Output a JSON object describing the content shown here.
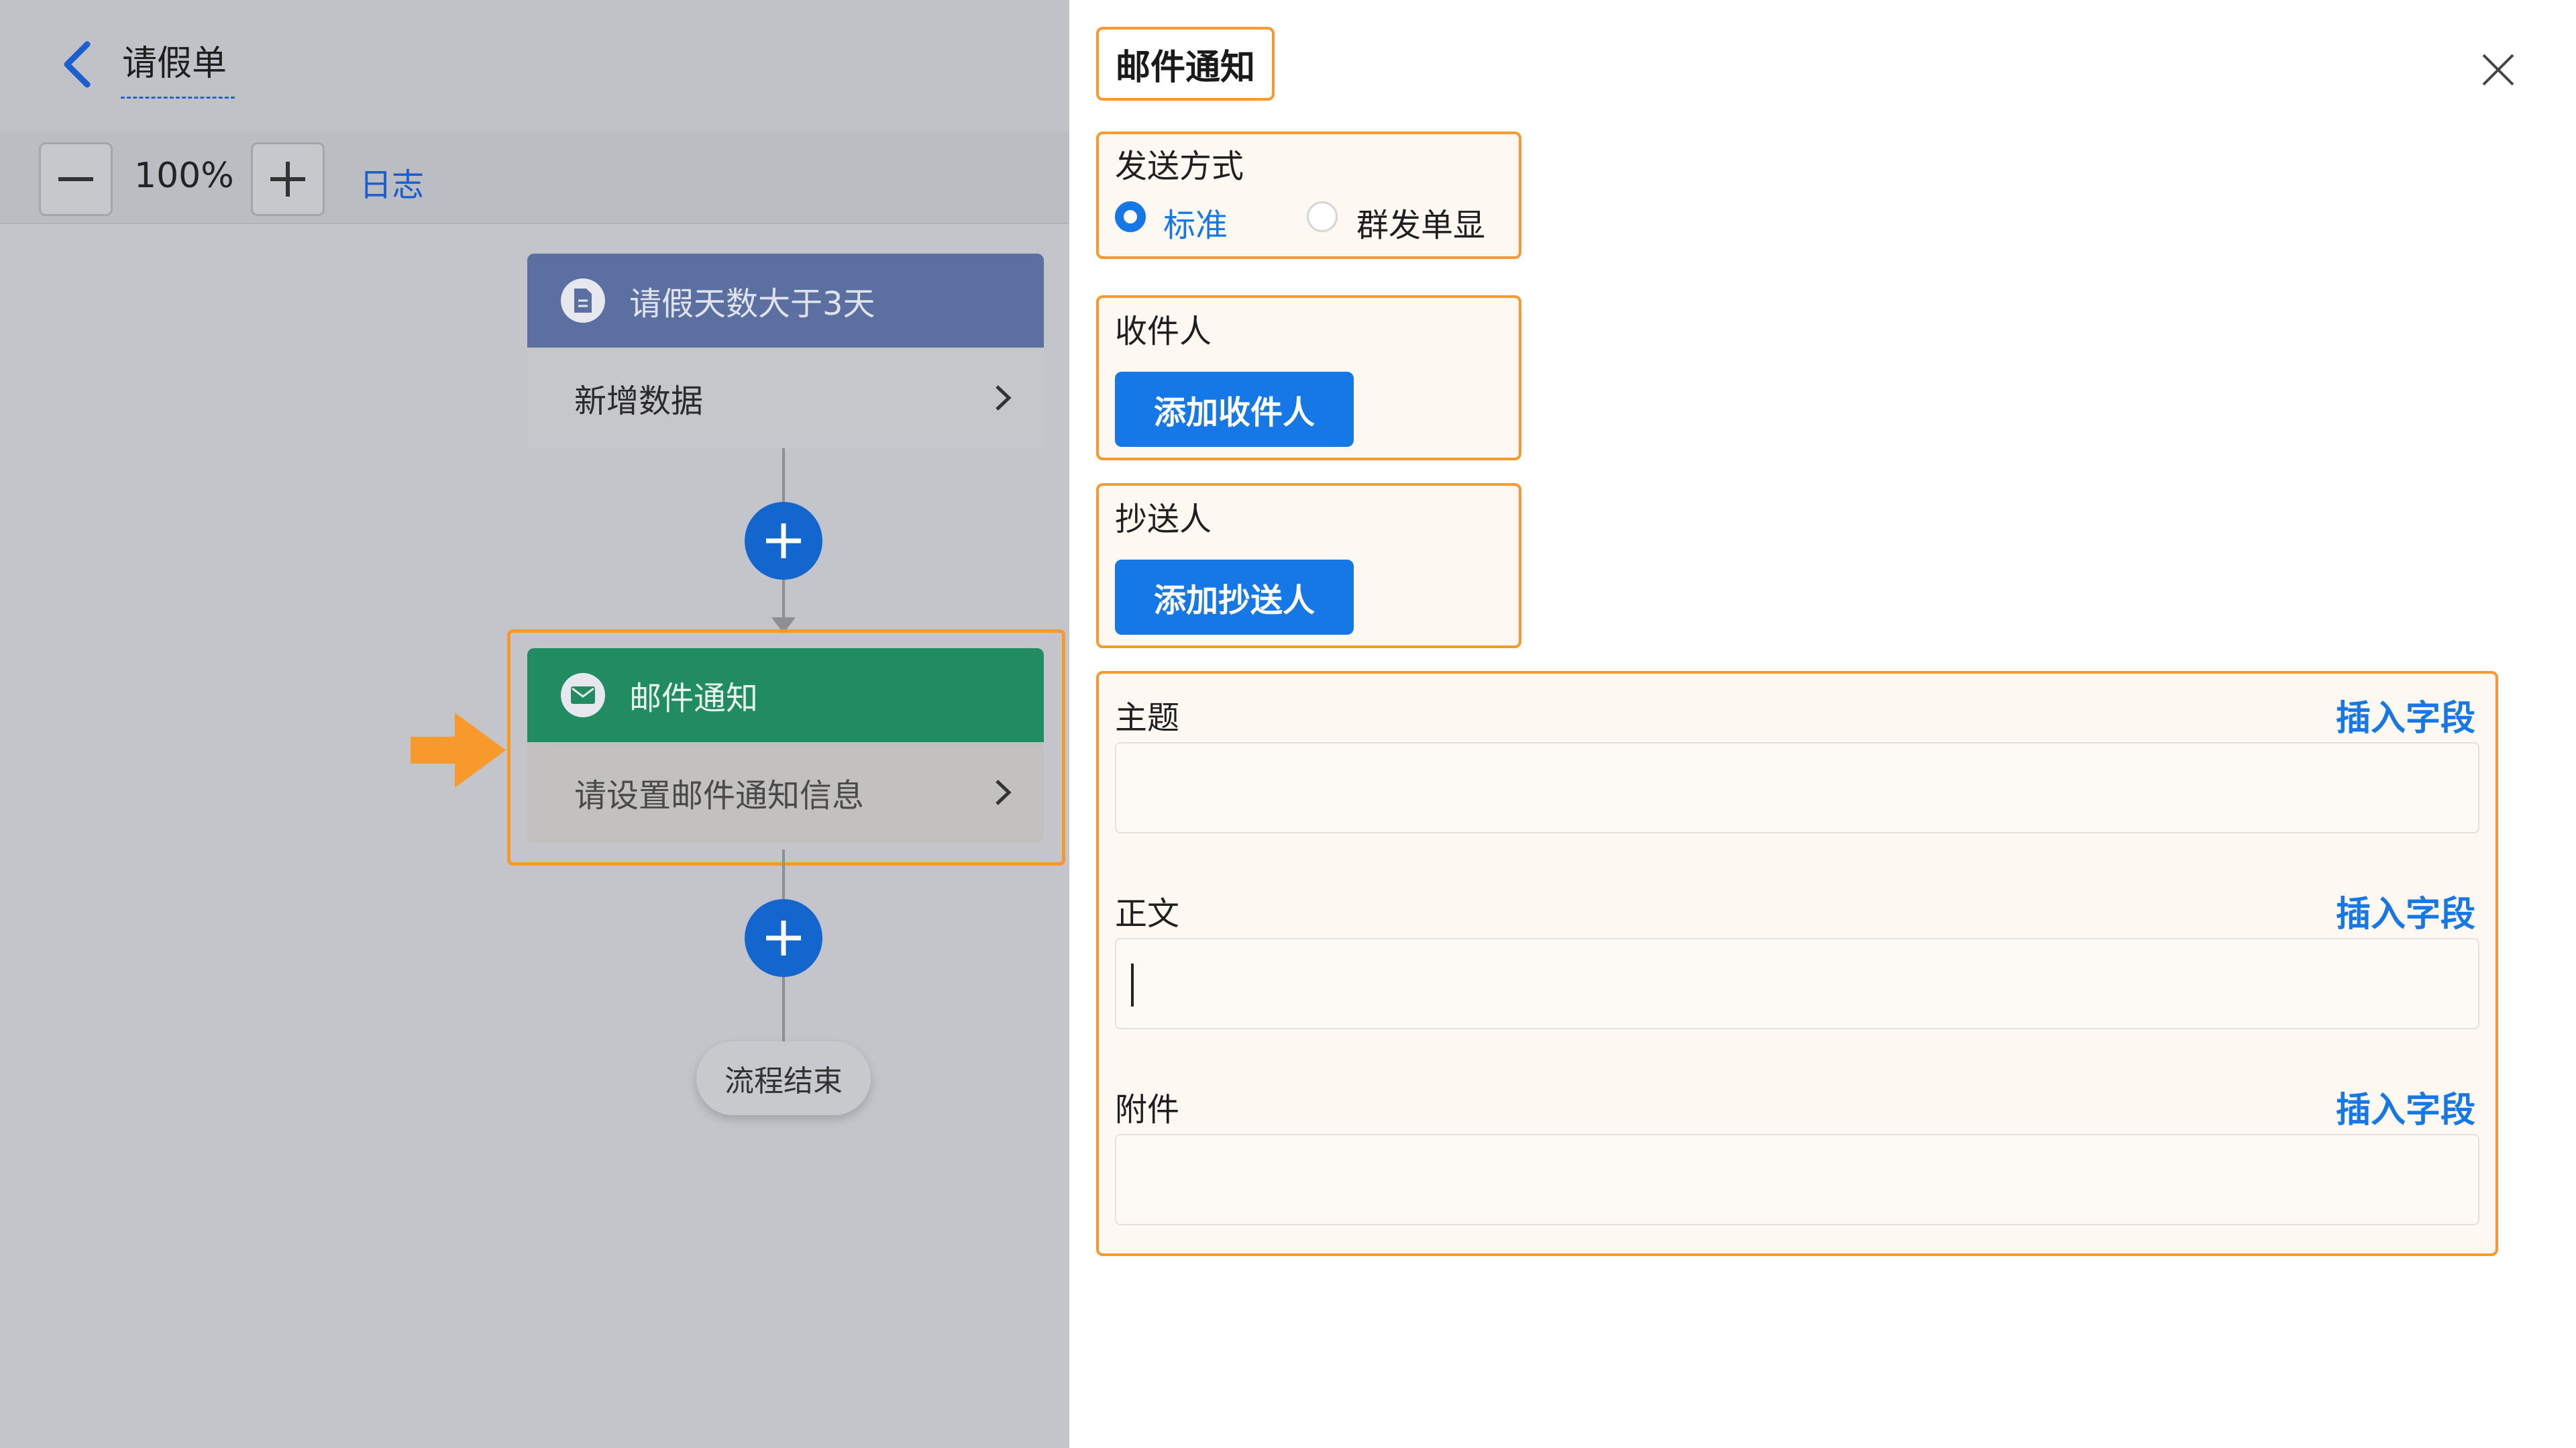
{
  "header": {
    "title": "请假单",
    "back_icon": "chevron-left-icon"
  },
  "toolbar": {
    "zoom_out_icon": "minus-icon",
    "zoom_level": "100%",
    "zoom_in_icon": "plus-icon",
    "log_label": "日志"
  },
  "flow": {
    "node1": {
      "title": "请假天数大于3天",
      "subtitle": "新增数据",
      "icon": "document-icon",
      "header_color": "#5b6fa0"
    },
    "node2": {
      "title": "邮件通知",
      "subtitle": "请设置邮件通知信息",
      "icon": "mail-icon",
      "header_color": "#218b62"
    },
    "end_label": "流程结束"
  },
  "panel": {
    "title": "邮件通知",
    "send_method": {
      "label": "发送方式",
      "options": [
        "标准",
        "群发单显"
      ],
      "selected": "标准"
    },
    "recipients": {
      "label": "收件人",
      "button": "添加收件人"
    },
    "cc": {
      "label": "抄送人",
      "button": "添加抄送人"
    },
    "subject": {
      "label": "主题",
      "insert": "插入字段",
      "value": ""
    },
    "body": {
      "label": "正文",
      "insert": "插入字段",
      "value": ""
    },
    "attachment": {
      "label": "附件",
      "insert": "插入字段",
      "value": ""
    }
  },
  "colors": {
    "accent": "#1677e6",
    "highlight": "#f79a2b"
  }
}
